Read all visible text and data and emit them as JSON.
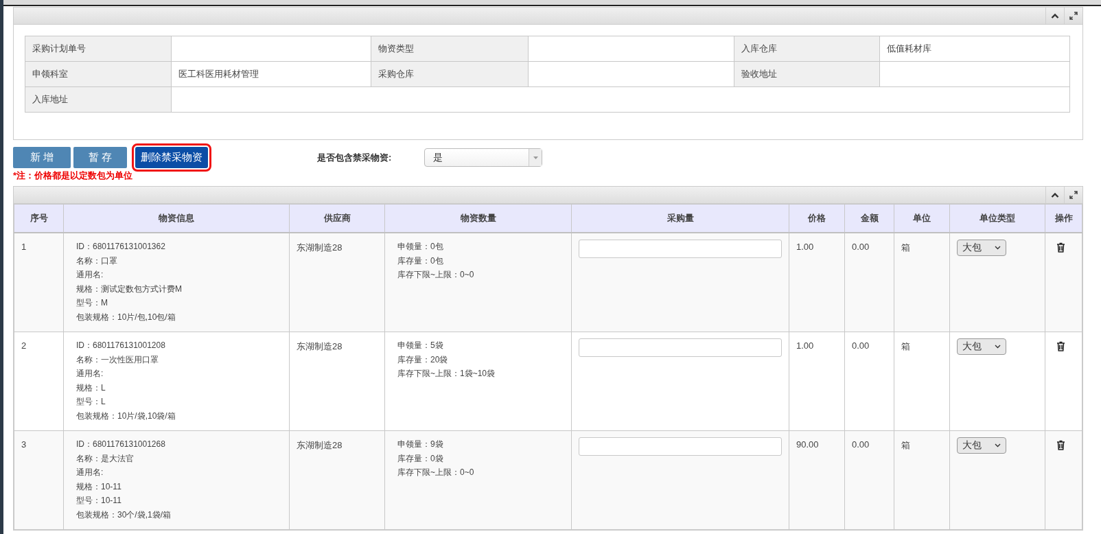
{
  "info_panel": {
    "fields": [
      {
        "label": "采购计划单号",
        "kind": "pair"
      },
      {
        "label": "物资类型",
        "kind": "pair"
      },
      {
        "label": "入库仓库",
        "value": "低值耗材库",
        "kind": "pair"
      },
      {
        "label": "申领科室",
        "value": "医工科医用耗材管理",
        "kind": "pair"
      },
      {
        "label": "采购仓库",
        "kind": "pair"
      },
      {
        "label": "验收地址",
        "kind": "pair"
      },
      {
        "label": "入库地址",
        "kind": "wide"
      }
    ]
  },
  "toolbar": {
    "buttons": [
      {
        "label": "新 增",
        "kind": "default",
        "highlighted": false
      },
      {
        "label": "暂 存",
        "kind": "default",
        "highlighted": false
      },
      {
        "label": "删除禁采物资",
        "kind": "dark",
        "highlighted": true
      }
    ],
    "filter": {
      "label": "是否包含禁采物资:",
      "value": "是"
    },
    "note": "*注：价格都是以定数包为单位"
  },
  "items_table": {
    "columns": [
      "序号",
      "物资信息",
      "供应商",
      "物资数量",
      "采购量",
      "价格",
      "金额",
      "单位",
      "单位类型",
      "操作"
    ],
    "rows": [
      {
        "index": "1",
        "info": [
          "ID：6801176131001362",
          "名称：口罩",
          "通用名:",
          "规格：测试定数包方式计费M",
          "型号：M",
          "包装规格：10片/包,10包/箱"
        ],
        "supplier": "东湖制造28",
        "quantity": [
          "申领量：0包",
          "库存量：0包",
          "库存下限~上限：0~0"
        ],
        "price": "1.00",
        "amount": "0.00",
        "unit": "箱",
        "unit_type": "大包"
      },
      {
        "index": "2",
        "info": [
          "ID：6801176131001208",
          "名称：一次性医用口罩",
          "通用名:",
          "规格：L",
          "型号：L",
          "包装规格：10片/袋,10袋/箱"
        ],
        "supplier": "东湖制造28",
        "quantity": [
          "申领量：5袋",
          "库存量：20袋",
          "库存下限~上限：1袋~10袋"
        ],
        "price": "1.00",
        "amount": "0.00",
        "unit": "箱",
        "unit_type": "大包"
      },
      {
        "index": "3",
        "info": [
          "ID：6801176131001268",
          "名称：是大法官",
          "通用名:",
          "规格：10-11",
          "型号：10-11",
          "包装规格：30个/袋,1袋/箱"
        ],
        "supplier": "东湖制造28",
        "quantity": [
          "申领量：9袋",
          "库存量：0袋",
          "库存下限~上限：0~0"
        ],
        "price": "90.00",
        "amount": "0.00",
        "unit": "箱",
        "unit_type": "大包"
      }
    ]
  }
}
